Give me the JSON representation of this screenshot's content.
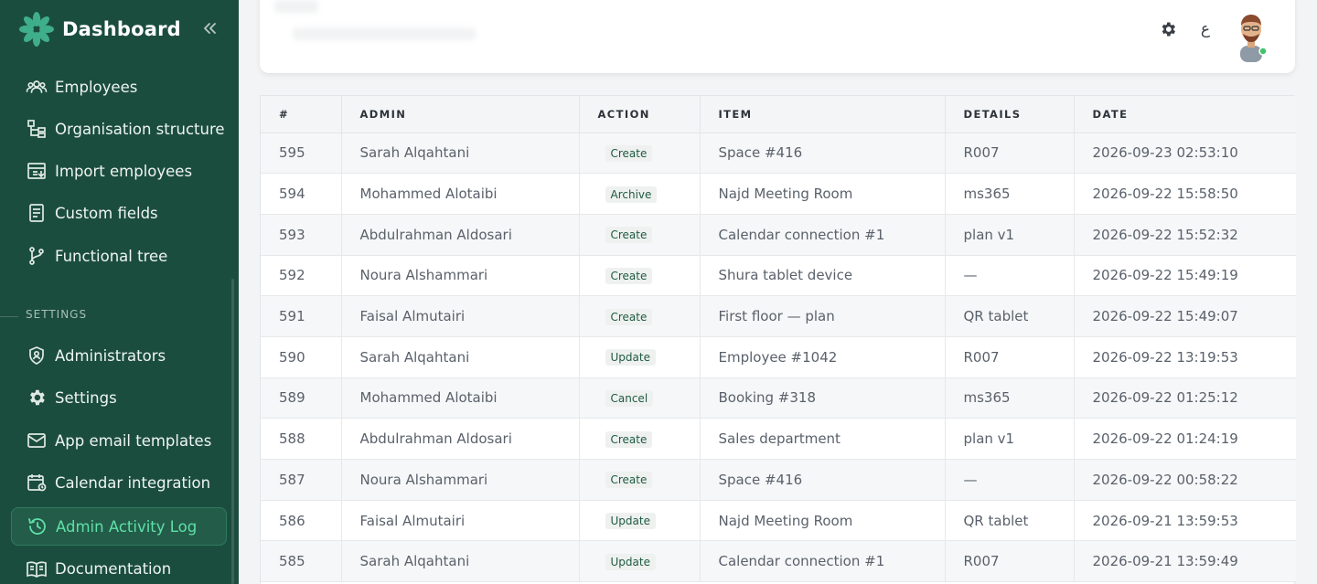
{
  "app": {
    "title": "Dashboard"
  },
  "sidebar": {
    "items": [
      {
        "label": "Employees",
        "icon": "users-icon"
      },
      {
        "label": "Organisation structure",
        "icon": "hierarchy-icon"
      },
      {
        "label": "Import employees",
        "icon": "import-icon"
      },
      {
        "label": "Custom fields",
        "icon": "form-icon"
      },
      {
        "label": "Functional tree",
        "icon": "branch-icon"
      }
    ],
    "settings_label": "SETTINGS",
    "settings_items": [
      {
        "label": "Administrators",
        "icon": "shield-icon"
      },
      {
        "label": "Settings",
        "icon": "gear-icon"
      },
      {
        "label": "App email templates",
        "icon": "mail-icon"
      },
      {
        "label": "Calendar integration",
        "icon": "calendar-icon"
      },
      {
        "label": "Admin Activity Log",
        "icon": "history-icon",
        "active": true
      },
      {
        "label": "Documentation",
        "icon": "book-icon"
      }
    ]
  },
  "header": {
    "language_toggle": "ع",
    "icons": [
      "settings-icon",
      "language-icon",
      "user-avatar"
    ]
  },
  "table": {
    "columns": [
      "#",
      "ADMIN",
      "ACTION",
      "ITEM",
      "DETAILS",
      "DATE"
    ],
    "rows": [
      {
        "id": "595",
        "admin": "Sarah Alqahtani",
        "action": "Create",
        "item": "Space #416",
        "details": "R007",
        "date": "2026-09-23 02:53:10"
      },
      {
        "id": "594",
        "admin": "Mohammed Alotaibi",
        "action": "Archive",
        "item": "Najd Meeting Room",
        "details": "ms365",
        "date": "2026-09-22 15:58:50"
      },
      {
        "id": "593",
        "admin": "Abdulrahman Aldosari",
        "action": "Create",
        "item": "Calendar connection #1",
        "details": "plan v1",
        "date": "2026-09-22 15:52:32"
      },
      {
        "id": "592",
        "admin": "Noura Alshammari",
        "action": "Create",
        "item": "Shura tablet device",
        "details": "—",
        "date": "2026-09-22 15:49:19"
      },
      {
        "id": "591",
        "admin": "Faisal Almutairi",
        "action": "Create",
        "item": "First floor — plan",
        "details": "QR tablet",
        "date": "2026-09-22 15:49:07"
      },
      {
        "id": "590",
        "admin": "Sarah Alqahtani",
        "action": "Update",
        "item": "Employee #1042",
        "details": "R007",
        "date": "2026-09-22 13:19:53"
      },
      {
        "id": "589",
        "admin": "Mohammed Alotaibi",
        "action": "Cancel",
        "item": "Booking #318",
        "details": "ms365",
        "date": "2026-09-22 01:25:12"
      },
      {
        "id": "588",
        "admin": "Abdulrahman Aldosari",
        "action": "Create",
        "item": "Sales department",
        "details": "plan v1",
        "date": "2026-09-22 01:24:19"
      },
      {
        "id": "587",
        "admin": "Noura Alshammari",
        "action": "Create",
        "item": "Space #416",
        "details": "—",
        "date": "2026-09-22 00:58:22"
      },
      {
        "id": "586",
        "admin": "Faisal Almutairi",
        "action": "Update",
        "item": "Najd Meeting Room",
        "details": "QR tablet",
        "date": "2026-09-21 13:59:53"
      },
      {
        "id": "585",
        "admin": "Sarah Alqahtani",
        "action": "Update",
        "item": "Calendar connection #1",
        "details": "R007",
        "date": "2026-09-21 13:59:49"
      }
    ]
  },
  "colors": {
    "sidebar_bg": "#1b4d3e",
    "accent": "#5fe0a8",
    "logo": "#3fae8a",
    "badge_bg": "#eef1ef",
    "badge_text": "#1f5a44"
  }
}
